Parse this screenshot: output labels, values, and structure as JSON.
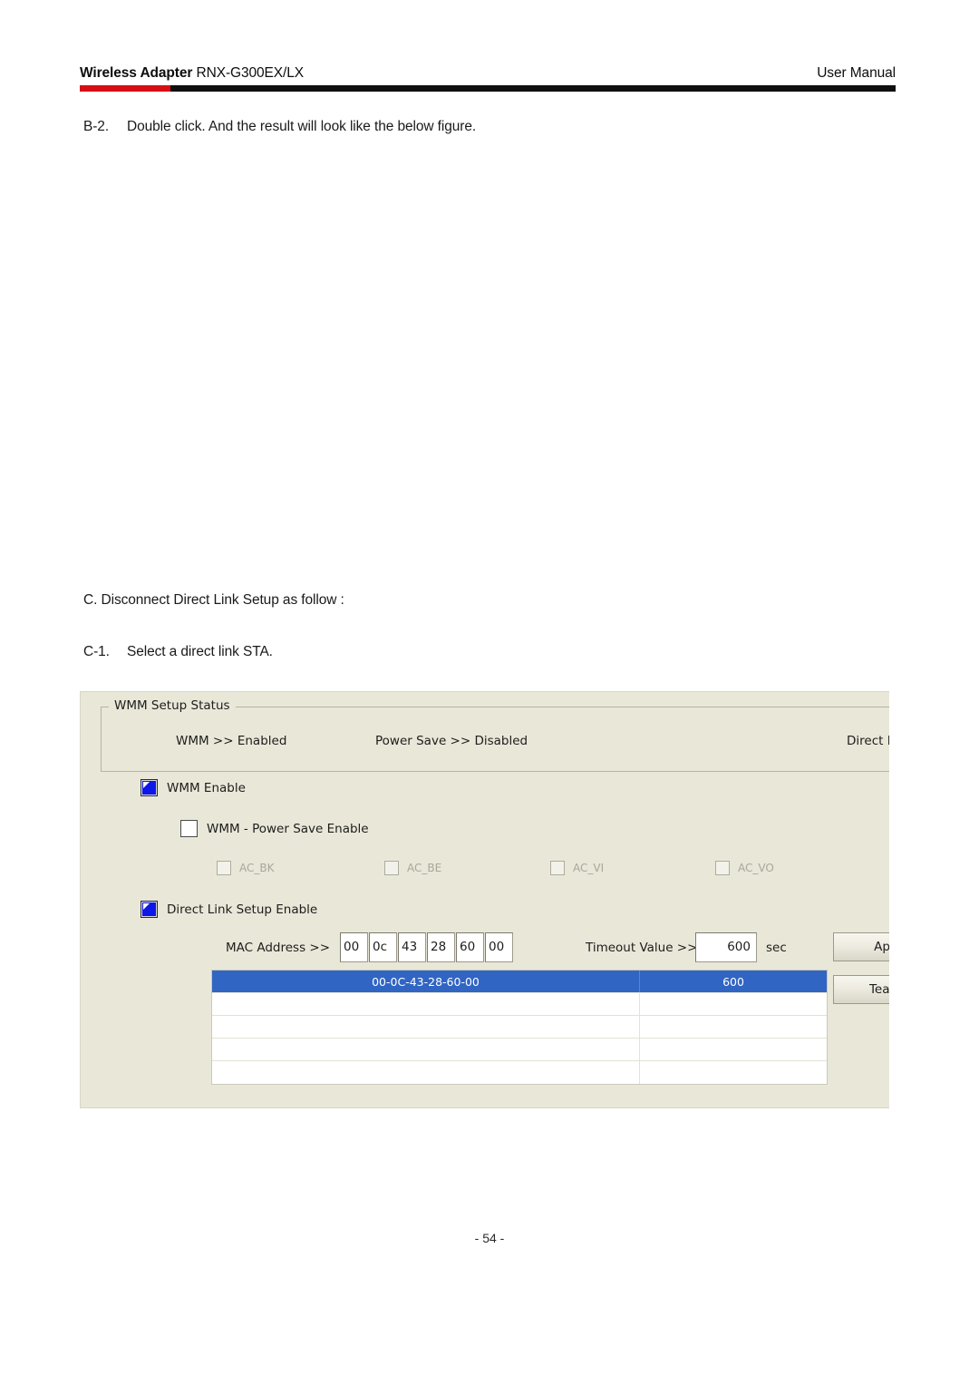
{
  "header": {
    "brand": "Wireless Adapter",
    "model": "RNX-G300EX/LX",
    "right": "User Manual",
    "rule_red": "#d60f14",
    "rule_black": "#101010"
  },
  "body": {
    "step_b2_label": "B-2.",
    "step_b2_text": "Double click. And the result will look like the below figure.",
    "section_c": "C. Disconnect Direct Link Setup as follow :",
    "step_c1_label": "C-1.",
    "step_c1_text": "Select a direct link STA."
  },
  "dialog": {
    "groupbox_title": "WMM Setup Status",
    "status": {
      "wmm": "WMM >> Enabled",
      "power_save": "Power Save >> Disabled",
      "direct_link": "Direct Lin"
    },
    "wmm_enable": {
      "label": "WMM Enable",
      "checked": true
    },
    "wmm_power_save": {
      "label": "WMM - Power Save Enable",
      "checked": false
    },
    "access_categories": [
      {
        "label": "AC_BK",
        "checked": false,
        "enabled": false
      },
      {
        "label": "AC_BE",
        "checked": false,
        "enabled": false
      },
      {
        "label": "AC_VI",
        "checked": false,
        "enabled": false
      },
      {
        "label": "AC_VO",
        "checked": false,
        "enabled": false
      }
    ],
    "direct_link_setup": {
      "label": "Direct Link Setup Enable",
      "checked": true
    },
    "mac_address": {
      "label": "MAC Address >>",
      "octets": [
        "00",
        "0c",
        "43",
        "28",
        "60",
        "00"
      ]
    },
    "timeout": {
      "label": "Timeout Value >>",
      "value": "600",
      "unit": "sec"
    },
    "buttons": {
      "apply": "Ap",
      "tear_down": "Tear"
    },
    "table": {
      "rows": [
        {
          "mac": "00-0C-43-28-60-00",
          "timeout": "600",
          "selected": true
        },
        {
          "mac": "",
          "timeout": "",
          "selected": false
        },
        {
          "mac": "",
          "timeout": "",
          "selected": false
        },
        {
          "mac": "",
          "timeout": "",
          "selected": false
        },
        {
          "mac": "",
          "timeout": "",
          "selected": false
        }
      ],
      "selected_color": "#3165c4"
    }
  },
  "footer": {
    "page_number": "- 54 -"
  }
}
